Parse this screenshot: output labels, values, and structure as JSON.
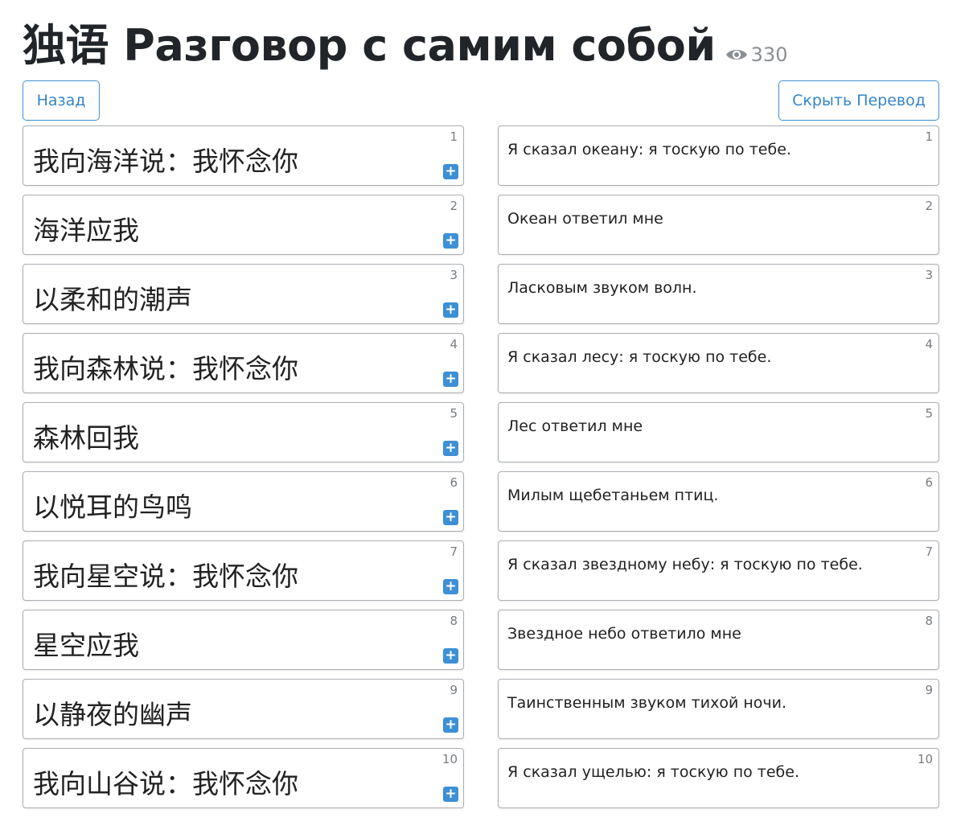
{
  "header": {
    "title": "独语 Разговор с самим собой",
    "views": "330"
  },
  "buttons": {
    "back": "Назад",
    "hide_translation": "Скрыть Перевод"
  },
  "icons": {
    "views": "eye-icon",
    "add": "plus-icon"
  },
  "colors": {
    "accent": "#3d8fd6",
    "border": "#a9aeb3"
  },
  "rows": [
    {
      "num": "1",
      "zh": "我向海洋说：我怀念你",
      "ru": "Я сказал океану: я тоскую по тебе.",
      "add": "+"
    },
    {
      "num": "2",
      "zh": "海洋应我",
      "ru": "Океан ответил мне",
      "add": "+"
    },
    {
      "num": "3",
      "zh": "以柔和的潮声",
      "ru": "Ласковым звуком волн.",
      "add": "+"
    },
    {
      "num": "4",
      "zh": "我向森林说：我怀念你",
      "ru": "Я сказал лесу: я тоскую по тебе.",
      "add": "+"
    },
    {
      "num": "5",
      "zh": "森林回我",
      "ru": "Лес ответил мне",
      "add": "+"
    },
    {
      "num": "6",
      "zh": "以悦耳的鸟鸣",
      "ru": "Милым щебетаньем птиц.",
      "add": "+"
    },
    {
      "num": "7",
      "zh": "我向星空说：我怀念你",
      "ru": "Я сказал звездному небу: я тоскую по тебе.",
      "add": "+"
    },
    {
      "num": "8",
      "zh": "星空应我",
      "ru": "Звездное небо ответило мне",
      "add": "+"
    },
    {
      "num": "9",
      "zh": "以静夜的幽声",
      "ru": "Таинственным звуком тихой ночи.",
      "add": "+"
    },
    {
      "num": "10",
      "zh": "我向山谷说：我怀念你",
      "ru": "Я сказал ущелью: я тоскую по тебе.",
      "add": "+"
    }
  ]
}
